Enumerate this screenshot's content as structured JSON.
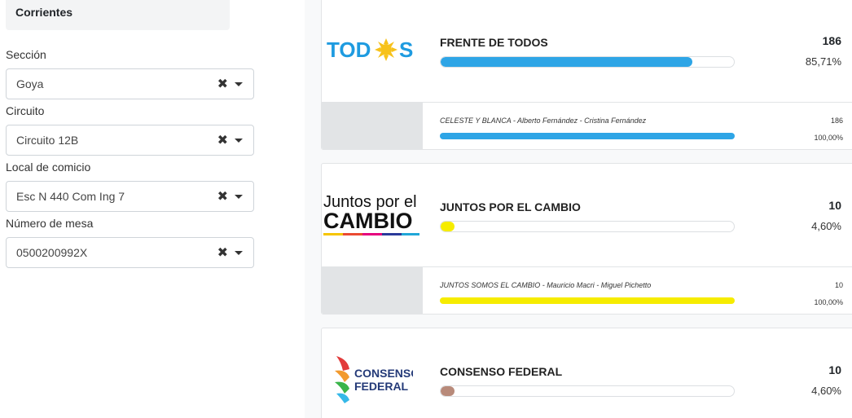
{
  "sidebar": {
    "tab_label": "Corrientes",
    "filters": [
      {
        "label": "Sección",
        "value": "Goya"
      },
      {
        "label": "Circuito",
        "value": "Circuito 12B"
      },
      {
        "label": "Local de comicio",
        "value": "Esc N 440 Com Ing 7"
      },
      {
        "label": "Número de mesa",
        "value": "0500200992X"
      }
    ],
    "clear_glyph": "✖"
  },
  "results": [
    {
      "logo_text": "TOD S",
      "name": "FRENTE DE TODOS",
      "votes": "186",
      "percent": "85,71%",
      "fill": 0.8571,
      "color": "#2ea5e6",
      "list": {
        "name": "CELESTE Y BLANCA - Alberto Fernández - Cristina Fernández",
        "votes": "186",
        "percent": "100,00%",
        "fill": 1.0
      }
    },
    {
      "logo_text_top": "Juntos por el",
      "logo_text_bottom": "CAMBIO",
      "name": "JUNTOS POR EL CAMBIO",
      "votes": "10",
      "percent": "4,60%",
      "fill": 0.046,
      "color": "#f6ec00",
      "list": {
        "name": "JUNTOS SOMOS EL CAMBIO - Mauricio Macri - Miguel Pichetto",
        "votes": "10",
        "percent": "100,00%",
        "fill": 1.0
      }
    },
    {
      "logo_text_top": "CONSENSO",
      "logo_text_bottom": "FEDERAL",
      "name": "CONSENSO FEDERAL",
      "votes": "10",
      "percent": "4,60%",
      "fill": 0.046,
      "color": "#b88a7a"
    }
  ]
}
